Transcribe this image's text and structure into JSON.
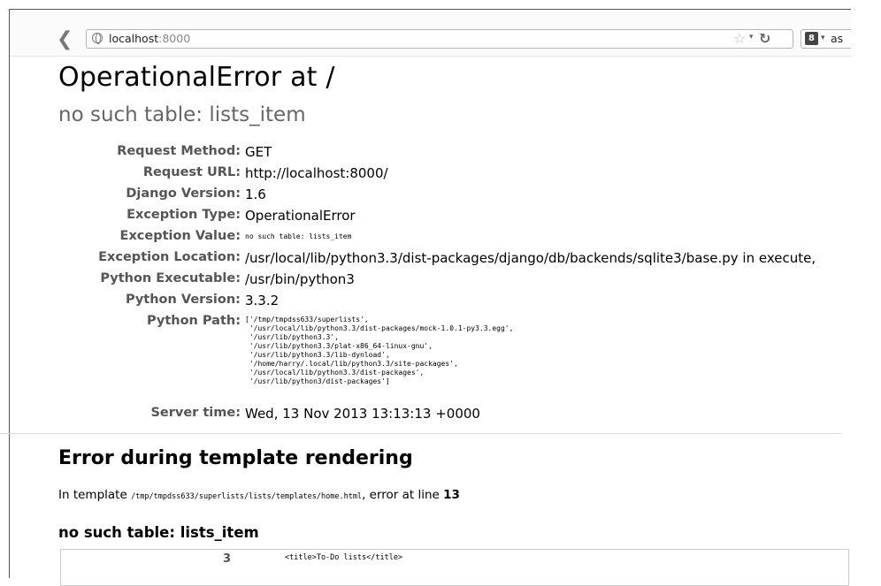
{
  "browser": {
    "url_host": "localhost",
    "url_port": ":8000",
    "search_text": "as",
    "icons": [
      "back-arrow-icon",
      "globe-icon",
      "bookmark-star-icon",
      "dropdown-icon",
      "reload-icon",
      "search-engine-icon"
    ]
  },
  "error": {
    "title": "OperationalError at /",
    "subtitle": "no such table: lists_item"
  },
  "meta": [
    {
      "label": "Request Method:",
      "value": "GET"
    },
    {
      "label": "Request URL:",
      "value": "http://localhost:8000/"
    },
    {
      "label": "Django Version:",
      "value": "1.6"
    },
    {
      "label": "Exception Type:",
      "value": "OperationalError"
    },
    {
      "label": "Exception Value:",
      "value": "no such table: lists_item"
    },
    {
      "label": "Exception Location:",
      "value": "/usr/local/lib/python3.3/dist-packages/django/db/backends/sqlite3/base.py in execute,"
    },
    {
      "label": "Python Executable:",
      "value": "/usr/bin/python3"
    },
    {
      "label": "Python Version:",
      "value": "3.3.2"
    },
    {
      "label": "Python Path:",
      "value": "['/tmp/tmpdss633/superlists',\n '/usr/local/lib/python3.3/dist-packages/mock-1.0.1-py3.3.egg',\n '/usr/lib/python3.3',\n '/usr/lib/python3.3/plat-x86_64-linux-gnu',\n '/usr/lib/python3.3/lib-dynload',\n '/home/harry/.local/lib/python3.3/site-packages',\n '/usr/local/lib/python3.3/dist-packages',\n '/usr/lib/python3/dist-packages']"
    },
    {
      "label": "Server time:",
      "value": "Wed, 13 Nov 2013 13:13:13 +0000"
    }
  ],
  "template": {
    "heading": "Error during template rendering",
    "in_prefix": "In template ",
    "path": "/tmp/tmpdss633/superlists/lists/templates/home.html",
    "error_at": ", error at line ",
    "line": "13",
    "error_heading": "no such table: lists_item",
    "code_line_number": "3",
    "code_line": "<title>To-Do lists</title>"
  }
}
